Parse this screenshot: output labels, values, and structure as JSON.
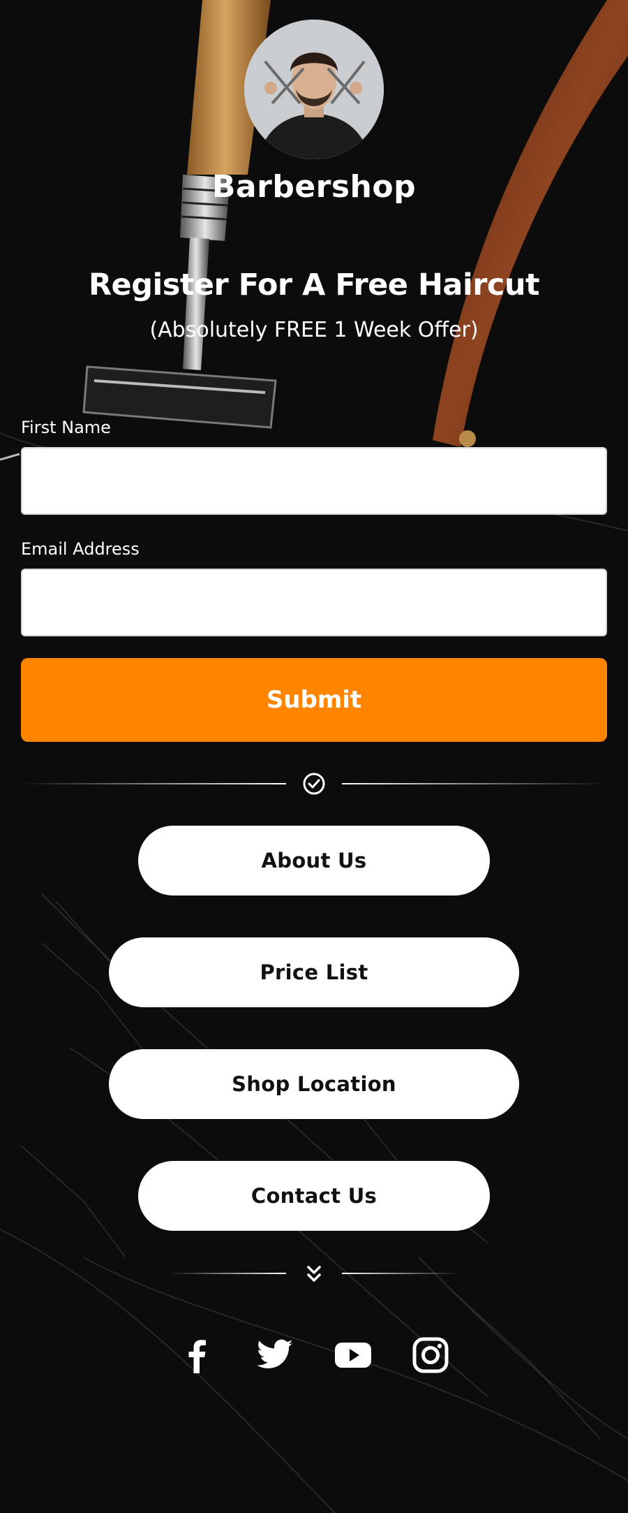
{
  "brand": {
    "name": "Barbershop"
  },
  "hero": {
    "headline": "Register For A Free Haircut",
    "subline": "(Absolutely FREE 1 Week Offer)"
  },
  "form": {
    "first_name_label": "First Name",
    "first_name_value": "",
    "email_label": "Email Address",
    "email_value": "",
    "submit_label": "Submit"
  },
  "links": [
    {
      "label": "About Us"
    },
    {
      "label": "Price List"
    },
    {
      "label": "Shop Location"
    },
    {
      "label": "Contact Us"
    }
  ],
  "social": [
    "facebook-icon",
    "twitter-icon",
    "youtube-icon",
    "instagram-icon"
  ],
  "colors": {
    "accent": "#ff8500",
    "background": "#0b0b0b",
    "button_bg": "#ffffff"
  }
}
